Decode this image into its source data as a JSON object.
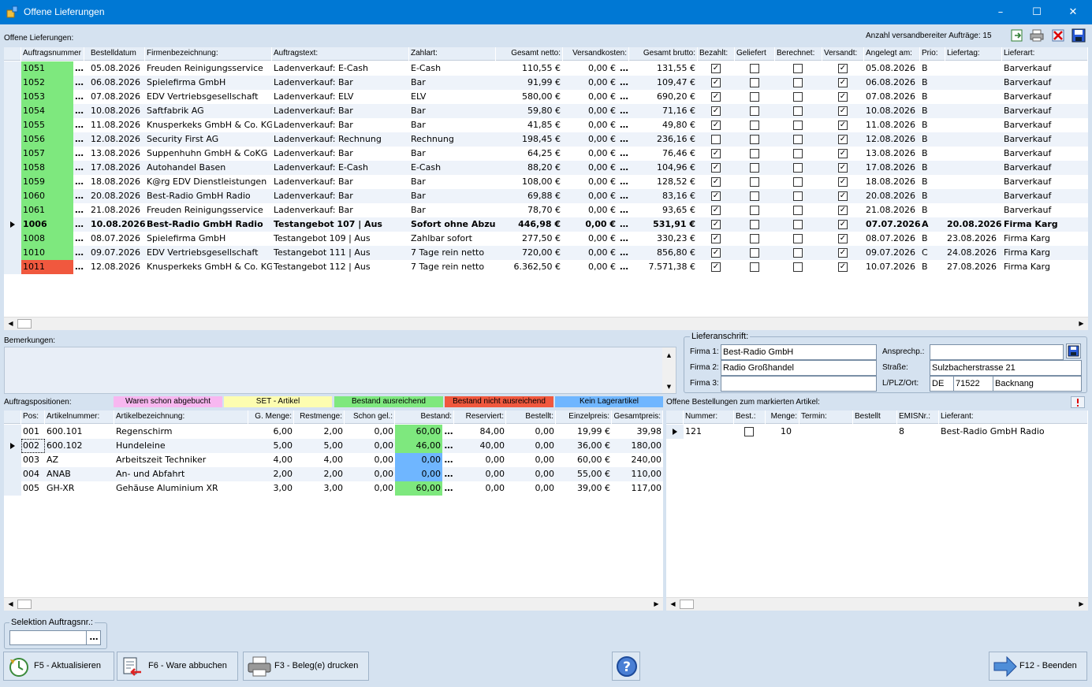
{
  "window": {
    "title": "Offene Lieferungen"
  },
  "orders": {
    "label": "Offene Lieferungen:",
    "count_label": "Anzahl versandbereiter Aufträge: 15",
    "columns": [
      "Auftragsnummer",
      "Bestelldatum",
      "Firmenbezeichnung:",
      "Auftragstext:",
      "Zahlart:",
      "Gesamt netto:",
      "Versandkosten:",
      "Gesamt brutto:",
      "Bezahlt:",
      "Geliefert",
      "Berechnet:",
      "Versandt:",
      "Angelegt am:",
      "Prio:",
      "Liefertag:",
      "Lieferart:"
    ],
    "rows": [
      {
        "nr": "1051",
        "color": "#7ee87e",
        "datum": "05.08.2026",
        "firma": "Freuden Reinigungsservice",
        "text": "Ladenverkauf: E-Cash",
        "zahlart": "E-Cash",
        "netto": "110,55 €",
        "versand": "0,00 €",
        "brutto": "131,55 €",
        "bezahlt": true,
        "geliefert": false,
        "berechnet": false,
        "versandt": true,
        "angelegt": "05.08.2026",
        "prio": "B",
        "liefertag": "",
        "lieferart": "Barverkauf",
        "bold": false,
        "sel": false
      },
      {
        "nr": "1052",
        "color": "#7ee87e",
        "datum": "06.08.2026",
        "firma": "Spielefirma GmbH",
        "text": "Ladenverkauf: Bar",
        "zahlart": "Bar",
        "netto": "91,99 €",
        "versand": "0,00 €",
        "brutto": "109,47 €",
        "bezahlt": true,
        "geliefert": false,
        "berechnet": false,
        "versandt": true,
        "angelegt": "06.08.2026",
        "prio": "B",
        "liefertag": "",
        "lieferart": "Barverkauf",
        "bold": false,
        "sel": false
      },
      {
        "nr": "1053",
        "color": "#7ee87e",
        "datum": "07.08.2026",
        "firma": "EDV Vertriebsgesellschaft",
        "text": "Ladenverkauf: ELV",
        "zahlart": "ELV",
        "netto": "580,00 €",
        "versand": "0,00 €",
        "brutto": "690,20 €",
        "bezahlt": true,
        "geliefert": false,
        "berechnet": false,
        "versandt": true,
        "angelegt": "07.08.2026",
        "prio": "B",
        "liefertag": "",
        "lieferart": "Barverkauf",
        "bold": false,
        "sel": false
      },
      {
        "nr": "1054",
        "color": "#7ee87e",
        "datum": "10.08.2026",
        "firma": "Saftfabrik AG",
        "text": "Ladenverkauf: Bar",
        "zahlart": "Bar",
        "netto": "59,80 €",
        "versand": "0,00 €",
        "brutto": "71,16 €",
        "bezahlt": true,
        "geliefert": false,
        "berechnet": false,
        "versandt": true,
        "angelegt": "10.08.2026",
        "prio": "B",
        "liefertag": "",
        "lieferart": "Barverkauf",
        "bold": false,
        "sel": false
      },
      {
        "nr": "1055",
        "color": "#7ee87e",
        "datum": "11.08.2026",
        "firma": "Knusperkeks GmbH & Co. KG",
        "text": "Ladenverkauf: Bar",
        "zahlart": "Bar",
        "netto": "41,85 €",
        "versand": "0,00 €",
        "brutto": "49,80 €",
        "bezahlt": true,
        "geliefert": false,
        "berechnet": false,
        "versandt": true,
        "angelegt": "11.08.2026",
        "prio": "B",
        "liefertag": "",
        "lieferart": "Barverkauf",
        "bold": false,
        "sel": false
      },
      {
        "nr": "1056",
        "color": "#7ee87e",
        "datum": "12.08.2026",
        "firma": "Security First AG",
        "text": "Ladenverkauf: Rechnung",
        "zahlart": "Rechnung",
        "netto": "198,45 €",
        "versand": "0,00 €",
        "brutto": "236,16 €",
        "bezahlt": false,
        "geliefert": false,
        "berechnet": false,
        "versandt": true,
        "angelegt": "12.08.2026",
        "prio": "B",
        "liefertag": "",
        "lieferart": "Barverkauf",
        "bold": false,
        "sel": false
      },
      {
        "nr": "1057",
        "color": "#7ee87e",
        "datum": "13.08.2026",
        "firma": "Suppenhuhn GmbH & CoKG",
        "text": "Ladenverkauf: Bar",
        "zahlart": "Bar",
        "netto": "64,25 €",
        "versand": "0,00 €",
        "brutto": "76,46 €",
        "bezahlt": true,
        "geliefert": false,
        "berechnet": false,
        "versandt": true,
        "angelegt": "13.08.2026",
        "prio": "B",
        "liefertag": "",
        "lieferart": "Barverkauf",
        "bold": false,
        "sel": false
      },
      {
        "nr": "1058",
        "color": "#7ee87e",
        "datum": "17.08.2026",
        "firma": "Autohandel Basen",
        "text": "Ladenverkauf: E-Cash",
        "zahlart": "E-Cash",
        "netto": "88,20 €",
        "versand": "0,00 €",
        "brutto": "104,96 €",
        "bezahlt": true,
        "geliefert": false,
        "berechnet": false,
        "versandt": true,
        "angelegt": "17.08.2026",
        "prio": "B",
        "liefertag": "",
        "lieferart": "Barverkauf",
        "bold": false,
        "sel": false
      },
      {
        "nr": "1059",
        "color": "#7ee87e",
        "datum": "18.08.2026",
        "firma": "K@rg EDV Dienstleistungen",
        "text": "Ladenverkauf: Bar",
        "zahlart": "Bar",
        "netto": "108,00 €",
        "versand": "0,00 €",
        "brutto": "128,52 €",
        "bezahlt": true,
        "geliefert": false,
        "berechnet": false,
        "versandt": true,
        "angelegt": "18.08.2026",
        "prio": "B",
        "liefertag": "",
        "lieferart": "Barverkauf",
        "bold": false,
        "sel": false
      },
      {
        "nr": "1060",
        "color": "#7ee87e",
        "datum": "20.08.2026",
        "firma": "Best-Radio GmbH Radio",
        "text": "Ladenverkauf: Bar",
        "zahlart": "Bar",
        "netto": "69,88 €",
        "versand": "0,00 €",
        "brutto": "83,16 €",
        "bezahlt": true,
        "geliefert": false,
        "berechnet": false,
        "versandt": true,
        "angelegt": "20.08.2026",
        "prio": "B",
        "liefertag": "",
        "lieferart": "Barverkauf",
        "bold": false,
        "sel": false
      },
      {
        "nr": "1061",
        "color": "#7ee87e",
        "datum": "21.08.2026",
        "firma": "Freuden Reinigungsservice",
        "text": "Ladenverkauf: Bar",
        "zahlart": "Bar",
        "netto": "78,70 €",
        "versand": "0,00 €",
        "brutto": "93,65 €",
        "bezahlt": true,
        "geliefert": false,
        "berechnet": false,
        "versandt": true,
        "angelegt": "21.08.2026",
        "prio": "B",
        "liefertag": "",
        "lieferart": "Barverkauf",
        "bold": false,
        "sel": false
      },
      {
        "nr": "1006",
        "color": "#7ee87e",
        "datum": "10.08.2026",
        "firma": "Best-Radio GmbH Radio",
        "text": "Testangebot 107 | Aus",
        "zahlart": "Sofort ohne Abzug",
        "netto": "446,98 €",
        "versand": "0,00 €",
        "brutto": "531,91 €",
        "bezahlt": true,
        "geliefert": false,
        "berechnet": false,
        "versandt": true,
        "angelegt": "07.07.2026",
        "prio": "A",
        "liefertag": "20.08.2026",
        "lieferart": "Firma Karg",
        "bold": true,
        "sel": true
      },
      {
        "nr": "1008",
        "color": "#7ee87e",
        "datum": "08.07.2026",
        "firma": "Spielefirma GmbH",
        "text": "Testangebot 109 | Aus",
        "zahlart": "Zahlbar sofort",
        "netto": "277,50 €",
        "versand": "0,00 €",
        "brutto": "330,23 €",
        "bezahlt": true,
        "geliefert": false,
        "berechnet": false,
        "versandt": true,
        "angelegt": "08.07.2026",
        "prio": "B",
        "liefertag": "23.08.2026",
        "lieferart": "Firma Karg",
        "bold": false,
        "sel": false
      },
      {
        "nr": "1010",
        "color": "#7ee87e",
        "datum": "09.07.2026",
        "firma": "EDV Vertriebsgesellschaft",
        "text": "Testangebot 111 | Aus",
        "zahlart": "7 Tage rein netto",
        "netto": "720,00 €",
        "versand": "0,00 €",
        "brutto": "856,80 €",
        "bezahlt": true,
        "geliefert": false,
        "berechnet": false,
        "versandt": true,
        "angelegt": "09.07.2026",
        "prio": "C",
        "liefertag": "24.08.2026",
        "lieferart": "Firma Karg",
        "bold": false,
        "sel": false
      },
      {
        "nr": "1011",
        "color": "#f0583e",
        "datum": "12.08.2026",
        "firma": "Knusperkeks GmbH & Co. KG",
        "text": "Testangebot 112 | Aus",
        "zahlart": "7 Tage rein netto",
        "netto": "6.362,50 €",
        "versand": "0,00 €",
        "brutto": "7.571,38 €",
        "bezahlt": true,
        "geliefert": false,
        "berechnet": false,
        "versandt": true,
        "angelegt": "10.07.2026",
        "prio": "B",
        "liefertag": "27.08.2026",
        "lieferart": "Firma Karg",
        "bold": false,
        "sel": false
      }
    ]
  },
  "remarks": {
    "label": "Bemerkungen:"
  },
  "address": {
    "legend": "Lieferanschrift:",
    "firma1_label": "Firma 1:",
    "firma1": "Best-Radio GmbH",
    "firma2_label": "Firma 2:",
    "firma2": "Radio Großhandel",
    "firma3_label": "Firma 3:",
    "firma3": "",
    "contact_label": "Ansprechp.:",
    "contact": "",
    "street_label": "Straße:",
    "street": "Sulzbacherstrasse 21",
    "city_label": "L/PLZ/Ort:",
    "country": "DE",
    "zip": "71522",
    "city": "Backnang"
  },
  "positions": {
    "label": "Auftragspositionen:",
    "legend": [
      {
        "text": "Waren schon abgebucht",
        "color": "#f7b7f0"
      },
      {
        "text": "SET - Artikel",
        "color": "#fdfdb0"
      },
      {
        "text": "Bestand ausreichend",
        "color": "#7ee87e"
      },
      {
        "text": "Bestand nicht ausreichend",
        "color": "#f0583e"
      },
      {
        "text": "Kein Lagerartikel",
        "color": "#6fb6ff"
      }
    ],
    "columns": [
      "Pos:",
      "Artikelnummer:",
      "Artikelbezeichnung:",
      "G. Menge:",
      "Restmenge:",
      "Schon gel.:",
      "Bestand:",
      "Reserviert:",
      "Bestellt:",
      "Einzelpreis:",
      "Gesamtpreis:"
    ],
    "rows": [
      {
        "pos": "001",
        "art": "600.101",
        "bez": "Regenschirm",
        "menge": "6,00",
        "rest": "2,00",
        "gel": "0,00",
        "bestand": "60,00",
        "bcolor": "#7ee87e",
        "res": "84,00",
        "best": "0,00",
        "ep": "19,99 €",
        "gp": "39,98",
        "sel": false
      },
      {
        "pos": "002",
        "art": "600.102",
        "bez": "Hundeleine",
        "menge": "5,00",
        "rest": "5,00",
        "gel": "0,00",
        "bestand": "46,00",
        "bcolor": "#7ee87e",
        "res": "40,00",
        "best": "0,00",
        "ep": "36,00 €",
        "gp": "180,00",
        "sel": true
      },
      {
        "pos": "003",
        "art": "AZ",
        "bez": "Arbeitszeit Techniker",
        "menge": "4,00",
        "rest": "4,00",
        "gel": "0,00",
        "bestand": "0,00",
        "bcolor": "#6fb6ff",
        "res": "0,00",
        "best": "0,00",
        "ep": "60,00 €",
        "gp": "240,00",
        "sel": false
      },
      {
        "pos": "004",
        "art": "ANAB",
        "bez": "An- und Abfahrt",
        "menge": "2,00",
        "rest": "2,00",
        "gel": "0,00",
        "bestand": "0,00",
        "bcolor": "#6fb6ff",
        "res": "0,00",
        "best": "0,00",
        "ep": "55,00 €",
        "gp": "110,00",
        "sel": false
      },
      {
        "pos": "005",
        "art": "GH-XR",
        "bez": "Gehäuse Aluminium XR",
        "menge": "3,00",
        "rest": "3,00",
        "gel": "0,00",
        "bestand": "60,00",
        "bcolor": "#7ee87e",
        "res": "0,00",
        "best": "0,00",
        "ep": "39,00 €",
        "gp": "117,00",
        "sel": false
      }
    ]
  },
  "purchase": {
    "label": "Offene Bestellungen zum markierten Artikel:",
    "columns": [
      "Nummer:",
      "Best.:",
      "Menge:",
      "Termin:",
      "Bestellt",
      "EMISNr.:",
      "Lieferant:"
    ],
    "rows": [
      {
        "nummer": "121",
        "best": false,
        "menge": "10",
        "termin": "",
        "bestellt": "",
        "emis": "8",
        "lieferant": "Best-Radio GmbH Radio"
      }
    ]
  },
  "selection": {
    "legend": "Selektion Auftragsnr.:",
    "value": ""
  },
  "buttons": {
    "refresh": "F5 - Aktualisieren",
    "book": "F6 - Ware abbuchen",
    "print": "F3 - Beleg(e) drucken",
    "exit": "F12 - Beenden"
  }
}
